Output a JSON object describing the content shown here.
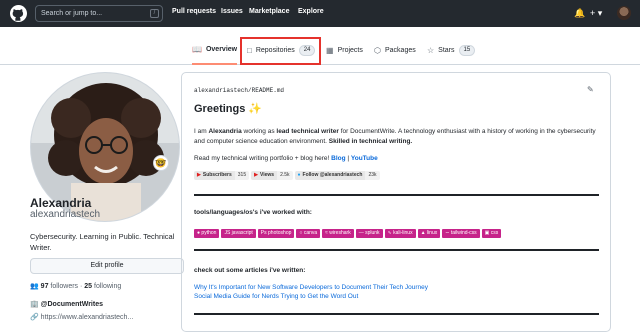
{
  "topbar": {
    "search_placeholder": "Search or jump to...",
    "search_shortcut": "/",
    "nav": [
      "Pull requests",
      "Issues",
      "Marketplace",
      "Explore"
    ],
    "bell_icon": "bell-icon",
    "plus_icon": "plus-icon"
  },
  "tabs": [
    {
      "label": "Overview",
      "icon": "book-open-icon",
      "count": ""
    },
    {
      "label": "Repositories",
      "icon": "repo-icon",
      "count": "24"
    },
    {
      "label": "Projects",
      "icon": "table-icon",
      "count": ""
    },
    {
      "label": "Packages",
      "icon": "package-icon",
      "count": ""
    },
    {
      "label": "Stars",
      "icon": "star-icon",
      "count": "15"
    }
  ],
  "profile": {
    "name": "Alexandria",
    "login": "alexandriastech",
    "bio": "Cybersecurity. Learning in Public. Technical Writer.",
    "edit_label": "Edit profile",
    "followers": "97",
    "followers_label": "followers",
    "following": "25",
    "following_label": "following",
    "org": "@DocumentWrites",
    "website": "https://www.alexandriastech..."
  },
  "readme": {
    "path_user": "alexandriastech",
    "path_sep": "/",
    "path_file": "README.md",
    "greeting": "Greetings ✨",
    "intro_1": "I am ",
    "intro_name": "Alexandria",
    "intro_2": " working as ",
    "intro_role": "lead technical writer",
    "intro_3": " for DocumentWrite. A technology enthusiast with a history of working in the cybersecurity and computer science education environment. ",
    "intro_skill": "Skilled in technical writing.",
    "portfolio_text": "Read my technical writing portfolio + blog here! ",
    "blog_link": "Blog",
    "sep": " | ",
    "youtube_link": "YouTube",
    "badges": [
      {
        "label": "Subscribers",
        "value": "315"
      },
      {
        "label": "Views",
        "value": "2.5k"
      },
      {
        "label": "Follow @alexandriastech",
        "value": "23k"
      }
    ],
    "tools_title": "tools/languages/os's i've worked with:",
    "tools": [
      "python",
      "javascript",
      "photoshop",
      "canva",
      "wireshark",
      "splunk",
      "kali-linux",
      "linux",
      "tailwind-css",
      "css"
    ],
    "articles_title": "check out some articles i've written:",
    "articles": [
      "Why It's Important for New Software Developers to Document Their Tech Journey",
      "Social Media Guide for Nerds Trying to Get the Word Out"
    ]
  },
  "colors": {
    "accent_tab": "#fd8c73",
    "tag_bg": "#c6238a",
    "highlight_box": "#e5322c",
    "link": "#0969da"
  }
}
